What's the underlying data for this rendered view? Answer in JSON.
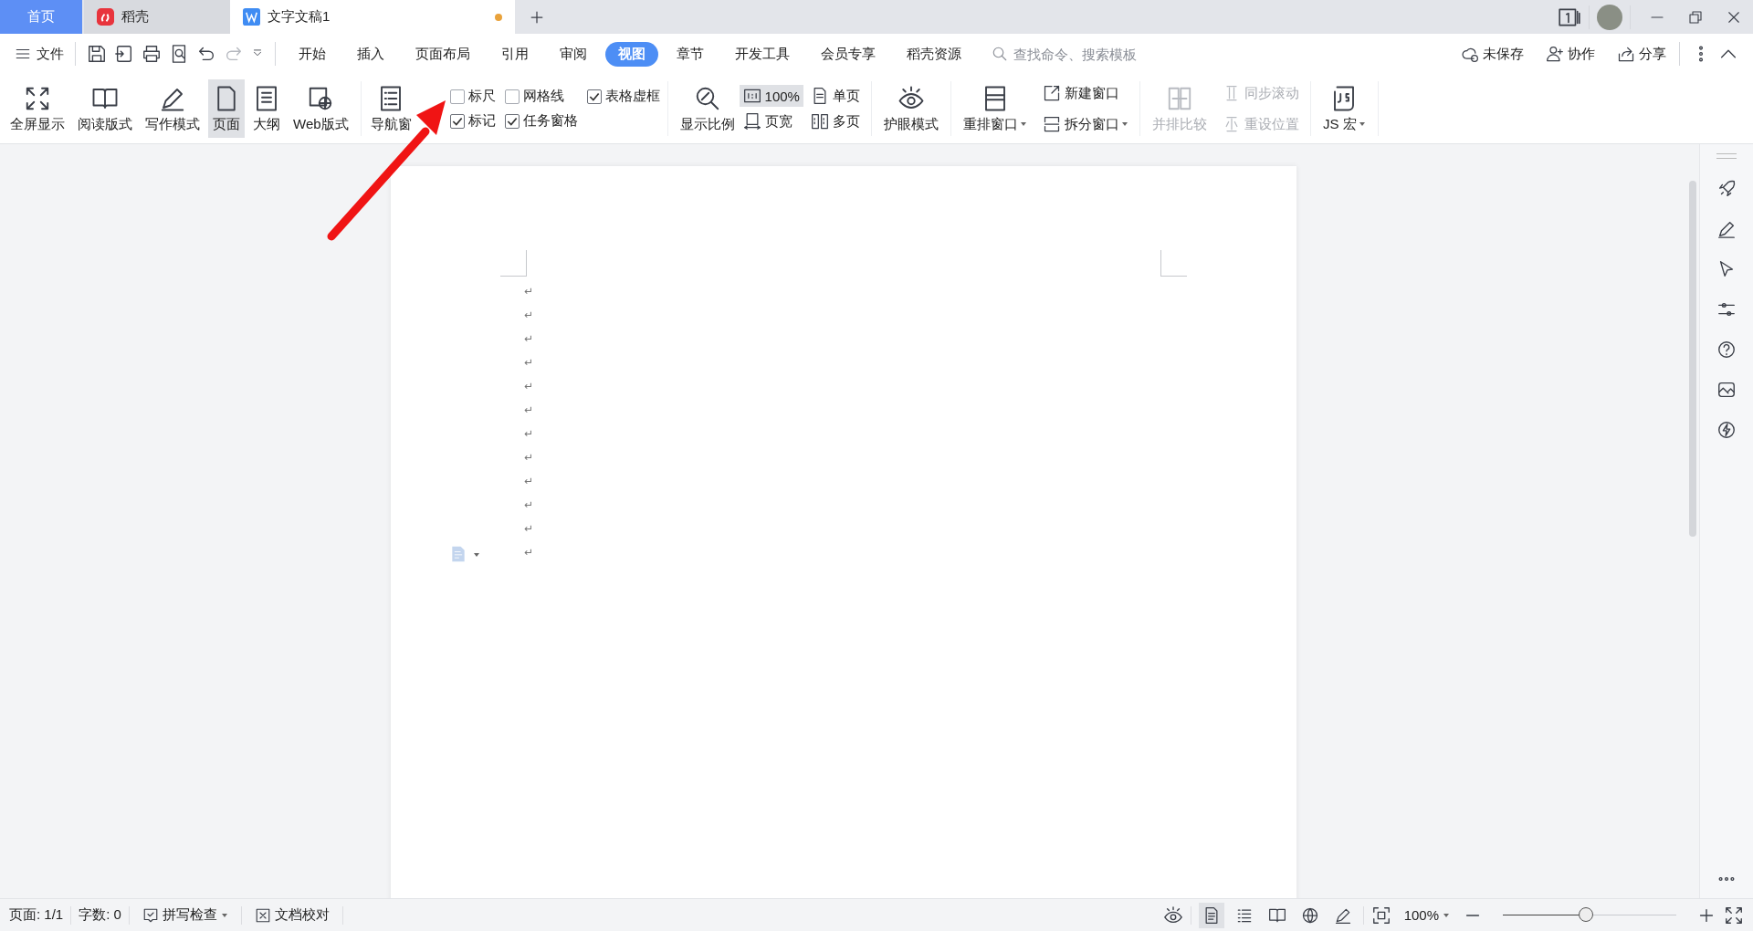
{
  "tabs": [
    {
      "label": "首页",
      "kind": "home",
      "selected": false
    },
    {
      "label": "稻壳",
      "kind": "docer",
      "selected": false
    },
    {
      "label": "文字文稿1",
      "kind": "doc",
      "selected": true,
      "unsaved": true
    }
  ],
  "file_menu": "文件",
  "menu_tabs": [
    {
      "label": "开始",
      "selected": false
    },
    {
      "label": "插入",
      "selected": false
    },
    {
      "label": "页面布局",
      "selected": false
    },
    {
      "label": "引用",
      "selected": false
    },
    {
      "label": "审阅",
      "selected": false
    },
    {
      "label": "视图",
      "selected": true
    },
    {
      "label": "章节",
      "selected": false
    },
    {
      "label": "开发工具",
      "selected": false
    },
    {
      "label": "会员专享",
      "selected": false
    },
    {
      "label": "稻壳资源",
      "selected": false
    }
  ],
  "search": {
    "placeholder": "查找命令、搜索模板"
  },
  "actions": [
    "未保存",
    "协作",
    "分享"
  ],
  "ribbon": {
    "view_modes": [
      {
        "label": "全屏显示",
        "selected": false
      },
      {
        "label": "阅读版式",
        "selected": false
      },
      {
        "label": "写作模式",
        "selected": false
      },
      {
        "label": "页面",
        "selected": true
      },
      {
        "label": "大纲",
        "selected": false
      },
      {
        "label": "Web版式",
        "selected": false
      }
    ],
    "nav_pane": "导航窗",
    "options": [
      {
        "label": "标尺",
        "checked": false
      },
      {
        "label": "网格线",
        "checked": false
      },
      {
        "label": "表格虚框",
        "checked": true
      },
      {
        "label": "标记",
        "checked": true
      },
      {
        "label": "任务窗格",
        "checked": true
      }
    ],
    "zoom": {
      "label": "显示比例",
      "ratio": {
        "label": "100%",
        "selected": true
      },
      "pages": [
        "单页",
        "页宽",
        "多页"
      ]
    },
    "eye_care": "护眼模式",
    "windows": [
      {
        "label": "重排窗口",
        "dropdown": true
      },
      {
        "label": "新建窗口",
        "dropdown": false
      },
      {
        "label": "拆分窗口",
        "dropdown": true
      }
    ],
    "compare": [
      {
        "label": "并排比较",
        "disabled": true
      },
      {
        "label": "同步滚动",
        "disabled": true
      },
      {
        "label": "重设位置",
        "disabled": true
      }
    ],
    "macro": {
      "label": "JS 宏",
      "dropdown": true
    }
  },
  "document": {
    "paragraph_marks": [
      "↵",
      "↵",
      "↵",
      "↵",
      "↵",
      "↵",
      "↵",
      "↵",
      "↵",
      "↵",
      "↵",
      "↵"
    ]
  },
  "status_bar": {
    "page": "页面: 1/1",
    "words": "字数: 0",
    "spell_check": "拼写检查",
    "proofread": "文档校对",
    "view_buttons": [
      {
        "kind": "page",
        "selected": true
      },
      {
        "kind": "outline",
        "selected": false
      },
      {
        "kind": "read",
        "selected": false
      },
      {
        "kind": "web",
        "selected": false
      },
      {
        "kind": "write",
        "selected": false
      }
    ],
    "zoom": "100%",
    "zoom_slider": {
      "level": 0.48
    }
  }
}
